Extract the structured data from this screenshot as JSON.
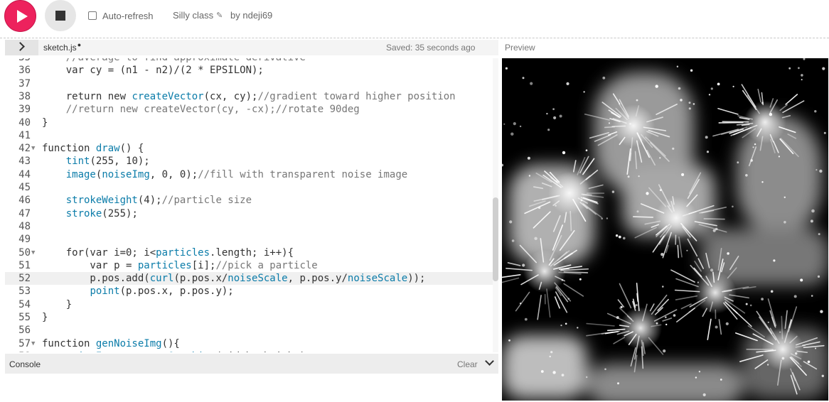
{
  "toolbar": {
    "play_icon": "play-icon",
    "stop_icon": "stop-icon",
    "autorefresh_label": "Auto-refresh",
    "autorefresh_checked": false,
    "project_name": "Silly class",
    "by_label": "by",
    "author": "ndeji69"
  },
  "tabbar": {
    "file_name": "sketch.js",
    "unsaved_marker": "●",
    "saved_status": "Saved: 35 seconds ago",
    "preview_label": "Preview"
  },
  "editor": {
    "active_line": 52,
    "lines": [
      {
        "n": "35",
        "t": "    //average to find approximate derivative",
        "fold": ""
      },
      {
        "n": "36",
        "t": "    var cy = (n1 - n2)/(2 * EPSILON);",
        "fold": ""
      },
      {
        "n": "37",
        "t": "",
        "fold": ""
      },
      {
        "n": "38",
        "t": "    return new createVector(cx, cy);//gradient toward higher position",
        "fold": ""
      },
      {
        "n": "39",
        "t": "    //return new createVector(cy, -cx);//rotate 90deg",
        "fold": ""
      },
      {
        "n": "40",
        "t": "}",
        "fold": ""
      },
      {
        "n": "41",
        "t": "",
        "fold": ""
      },
      {
        "n": "42",
        "t": "function draw() {",
        "fold": "▼"
      },
      {
        "n": "43",
        "t": "    tint(255, 10);",
        "fold": ""
      },
      {
        "n": "44",
        "t": "    image(noiseImg, 0, 0);//fill with transparent noise image",
        "fold": ""
      },
      {
        "n": "45",
        "t": "",
        "fold": ""
      },
      {
        "n": "46",
        "t": "    strokeWeight(4);//particle size",
        "fold": ""
      },
      {
        "n": "47",
        "t": "    stroke(255);",
        "fold": ""
      },
      {
        "n": "48",
        "t": "",
        "fold": ""
      },
      {
        "n": "49",
        "t": "",
        "fold": ""
      },
      {
        "n": "50",
        "t": "    for(var i=0; i<particles.length; i++){",
        "fold": "▼"
      },
      {
        "n": "51",
        "t": "        var p = particles[i];//pick a particle",
        "fold": ""
      },
      {
        "n": "52",
        "t": "        p.pos.add(curl(p.pos.x/noiseScale, p.pos.y/noiseScale));",
        "fold": ""
      },
      {
        "n": "53",
        "t": "        point(p.pos.x, p.pos.y);",
        "fold": ""
      },
      {
        "n": "54",
        "t": "    }",
        "fold": ""
      },
      {
        "n": "55",
        "t": "}",
        "fold": ""
      },
      {
        "n": "56",
        "t": "",
        "fold": ""
      },
      {
        "n": "57",
        "t": "function genNoiseImg(){",
        "fold": "▼"
      },
      {
        "n": "58",
        "t": "    noiseImg = createGraphics(width, height);",
        "fold": ""
      }
    ]
  },
  "console": {
    "title": "Console",
    "clear_label": "Clear",
    "toggle_icon": "chevron-down-icon"
  },
  "colors": {
    "accent": "#ed225d",
    "preview_bg": "#000000"
  }
}
